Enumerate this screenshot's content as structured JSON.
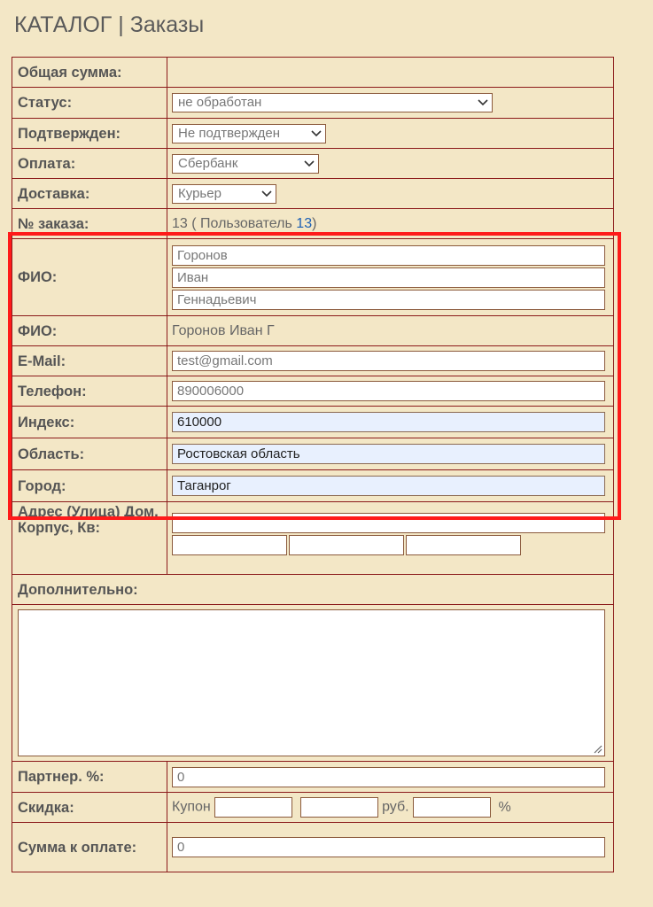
{
  "page": {
    "title": "КАТАЛОГ | Заказы"
  },
  "form": {
    "total": {
      "label": "Общая сумма:",
      "value": ""
    },
    "status": {
      "label": "Статус:",
      "value": "не обработан"
    },
    "confirmed": {
      "label": "Подтвержден:",
      "value": "Не подтвержден"
    },
    "payment": {
      "label": "Оплата:",
      "value": "Сбербанк"
    },
    "delivery": {
      "label": "Доставка:",
      "value": "Курьер"
    },
    "order_number": {
      "label": "№ заказа:",
      "prefix": "13 ( Пользователь ",
      "user_link": "13",
      "suffix": ")"
    },
    "fio_fields": {
      "label": "ФИО:",
      "last_name": "Горонов",
      "first_name": "Иван",
      "middle_name": "Геннадьевич"
    },
    "fio_text": {
      "label": "ФИО:",
      "value": "Горонов Иван Г"
    },
    "email": {
      "label": "E-Mail:",
      "value": "test@gmail.com"
    },
    "phone": {
      "label": "Телефон:",
      "value": "890006000"
    },
    "index": {
      "label": "Индекс:",
      "value": "610000"
    },
    "region": {
      "label": "Область:",
      "value": "Ростовская область"
    },
    "city": {
      "label": "Город:",
      "value": "Таганрог"
    },
    "address": {
      "label": "Адрес (Улица) Дом, Корпус, Кв:",
      "street": "",
      "house": "",
      "building": "",
      "apartment": ""
    },
    "additional": {
      "label": "Дополнительно:",
      "value": ""
    },
    "partner": {
      "label": "Партнер. %:",
      "value": "0"
    },
    "discount": {
      "label": "Скидка:",
      "coupon_label": "Купон",
      "coupon_1": "",
      "coupon_2": "",
      "rub_label": "руб.",
      "percent_value": "",
      "percent_label": "%"
    },
    "to_pay": {
      "label": "Сумма к оплате:",
      "value": "0"
    }
  },
  "colors": {
    "background": "#f3e7c6",
    "border": "#8b1a1a",
    "highlight": "#ff1a1a",
    "autofill": "#e8f0fe",
    "link": "#1a5fb4"
  },
  "icons": {
    "select": "chevron-down-icon",
    "textarea": "resize-handle-icon"
  }
}
